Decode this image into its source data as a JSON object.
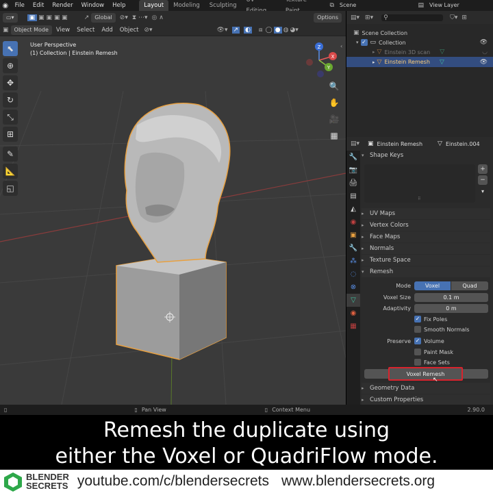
{
  "top_menu": [
    "File",
    "Edit",
    "Render",
    "Window",
    "Help"
  ],
  "workspaces": [
    "Layout",
    "Modeling",
    "Sculpting",
    "UV Editing",
    "Texture Paint"
  ],
  "active_workspace": "Layout",
  "scene": "Scene",
  "view_layer": "View Layer",
  "header3d": {
    "orientation": "Global",
    "options": "Options"
  },
  "header3d_row2": {
    "mode": "Object Mode",
    "menus": [
      "View",
      "Select",
      "Add",
      "Object"
    ]
  },
  "viewport": {
    "line1": "User Perspective",
    "line2": "(1) Collection | Einstein Remesh"
  },
  "gizmo": {
    "x": "X",
    "y": "Y",
    "z": "Z"
  },
  "outliner": {
    "root": "Scene Collection",
    "collection": "Collection",
    "items": [
      "Einstein 3D scan",
      "Einstein Remesh"
    ]
  },
  "props_header": {
    "object": "Einstein Remesh",
    "mesh": "Einstein.004"
  },
  "panels_top": [
    "Shape Keys"
  ],
  "panels_mid": [
    "UV Maps",
    "Vertex Colors",
    "Face Maps",
    "Normals",
    "Texture Space",
    "Remesh"
  ],
  "remesh": {
    "mode_label": "Mode",
    "mode_voxel": "Voxel",
    "mode_quad": "Quad",
    "voxel_size_label": "Voxel Size",
    "voxel_size": "0.1 m",
    "adaptivity_label": "Adaptivity",
    "adaptivity": "0 m",
    "fix_poles": "Fix Poles",
    "smooth_normals": "Smooth Normals",
    "preserve_label": "Preserve",
    "volume": "Volume",
    "paint_mask": "Paint Mask",
    "face_sets": "Face Sets",
    "button": "Voxel Remesh"
  },
  "panels_bottom": [
    "Geometry Data",
    "Custom Properties"
  ],
  "statusbar": {
    "pan": "Pan View",
    "context": "Context Menu",
    "version": "2.90.0"
  },
  "caption": {
    "line1": "Remesh the duplicate using",
    "line2": "either the Voxel or QuadriFlow mode."
  },
  "footer": {
    "logo1": "BLENDER",
    "logo2": "SECRETS",
    "youtube": "youtube.com/c/blendersecrets",
    "site": "www.blendersecrets.org"
  },
  "colors": {
    "accent": "#4772b3",
    "highlight": "#d9232d",
    "orange": "#e8a040"
  }
}
